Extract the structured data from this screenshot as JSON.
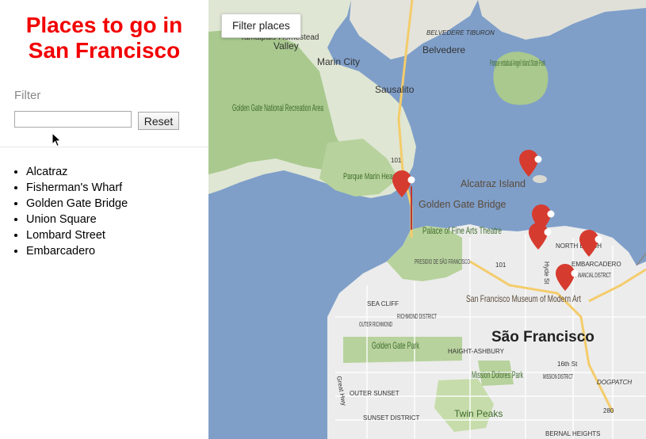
{
  "sidebar": {
    "title_line1": "Places to go in",
    "title_line2": "San Francisco",
    "filter_label": "Filter",
    "filter_value": "",
    "reset_label": "Reset",
    "places": [
      "Alcatraz",
      "Fisherman's Wharf",
      "Golden Gate Bridge",
      "Union Square",
      "Lombard Street",
      "Embarcadero"
    ]
  },
  "map": {
    "filter_button_label": "Filter places",
    "labels": {
      "sausalito_peak": "Tamalpais-Homestead",
      "valley": "Valley",
      "marin_city": "Marin City",
      "belvedere_tiburon": "BELVEDERE TIBURON",
      "belvedere": "Belvedere",
      "parque_estadual": "Parque estadual Angel Island State Park",
      "sausalito": "Sausalito",
      "ggnra": "Golden Gate National Recreation Area",
      "parque_marin": "Parque Marin Headlands",
      "route_101_north": "101",
      "alcatraz_island": "Alcatraz Island",
      "golden_gate_bridge": "Golden Gate Bridge",
      "palace_fine_arts": "Palace of Fine Arts Theatre",
      "presidio": "PRESIDIO DE SÃO FRANCISCO",
      "route_101_south": "101",
      "north_beach": "NORTH BEACH",
      "hyde_st": "Hyde St",
      "embarcadero": "EMBARCADERO",
      "financial_district": "FINANCIAL DISTRICT",
      "sea_cliff": "SEA CLIFF",
      "richmond": "RICHMOND DISTRICT",
      "outer_richmond": "OUTER RICHMOND",
      "sfmoma": "San Francisco Museum of Modern Art",
      "sao_francisco": "São Francisco",
      "golden_gate_park": "Golden Gate Park",
      "haight_ashbury": "HAIGHT-ASHBURY",
      "mission_dolores": "Mission Dolores Park",
      "mission_district": "MISSION DISTRICT",
      "street_16th": "16th St",
      "dogpatch": "DOGPATCH",
      "outer_sunset": "OUTER SUNSET",
      "great_hwy": "Great Hwy",
      "sunset_district": "SUNSET DISTRICT",
      "twin_peaks": "Twin Peaks",
      "route_280": "280",
      "bernal_heights": "BERNAL HEIGHTS"
    },
    "marker_color": "#d63b2f",
    "water_color": "#7f9fc9",
    "land_color": "#ececec",
    "park_color": "#c6dcaa"
  }
}
